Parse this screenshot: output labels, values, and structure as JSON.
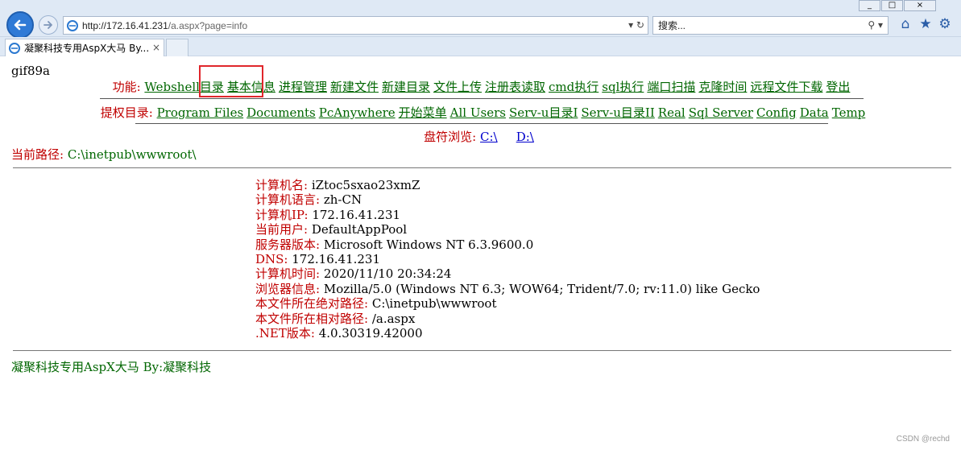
{
  "browser": {
    "url_host": "http://172.16.41.231",
    "url_path": "/a.aspx?page=info",
    "search_placeholder": "搜索...",
    "tab_title": "凝聚科技专用AspX大马 By...",
    "tab_close": "×",
    "addr_tools": "▾ ↻",
    "search_tools": "⚲ ▾",
    "icons": [
      "home-icon",
      "favorites-star-icon",
      "tools-gear-icon"
    ],
    "win_controls": [
      "_",
      "□",
      "×"
    ]
  },
  "page": {
    "gif_text": "gif89a",
    "func_label": "功能:",
    "func_links": [
      "Webshell目录",
      "基本信息",
      "进程管理",
      "新建文件",
      "新建目录",
      "文件上传",
      "注册表读取",
      "cmd执行",
      "sql执行",
      "端口扫描",
      "克隆时间",
      "远程文件下载",
      "登出"
    ],
    "priv_label": "提权目录:",
    "priv_links": [
      "Program Files",
      "Documents",
      "PcAnywhere",
      "开始菜单",
      "All Users",
      "Serv-u目录I",
      "Serv-u目录II",
      "Real",
      "Sql Server",
      "Config",
      "Data",
      "Temp"
    ],
    "drive_label": "盘符浏览:",
    "drive_links": [
      "C:\\",
      "D:\\"
    ],
    "path_label": "当前路径:",
    "path_value": "C:\\inetpub\\wwwroot\\",
    "info": [
      {
        "label": "计算机名:",
        "value": "iZtoc5sxao23xmZ"
      },
      {
        "label": "计算机语言:",
        "value": "zh-CN"
      },
      {
        "label": "计算机IP:",
        "value": "172.16.41.231"
      },
      {
        "label": "当前用户:",
        "value": "DefaultAppPool"
      },
      {
        "label": "服务器版本:",
        "value": "Microsoft Windows NT 6.3.9600.0"
      },
      {
        "label": "DNS:",
        "value": "172.16.41.231"
      },
      {
        "label": "计算机时间:",
        "value": "2020/11/10 20:34:24"
      },
      {
        "label": "浏览器信息:",
        "value": "Mozilla/5.0 (Windows NT 6.3; WOW64; Trident/7.0; rv:11.0) like Gecko"
      },
      {
        "label": "本文件所在绝对路径:",
        "value": "C:\\inetpub\\wwwroot"
      },
      {
        "label": "本文件所在相对路径:",
        "value": "/a.aspx"
      },
      {
        "label": ".NET版本:",
        "value": "4.0.30319.42000"
      }
    ],
    "footer": "凝聚科技专用AspX大马 By:凝聚科技",
    "watermark": "CSDN @rechd"
  },
  "colors": {
    "label_red": "#c00000",
    "link_green": "#006600",
    "drive_blue": "#0000cc",
    "highlight_box": "#e0262b"
  }
}
